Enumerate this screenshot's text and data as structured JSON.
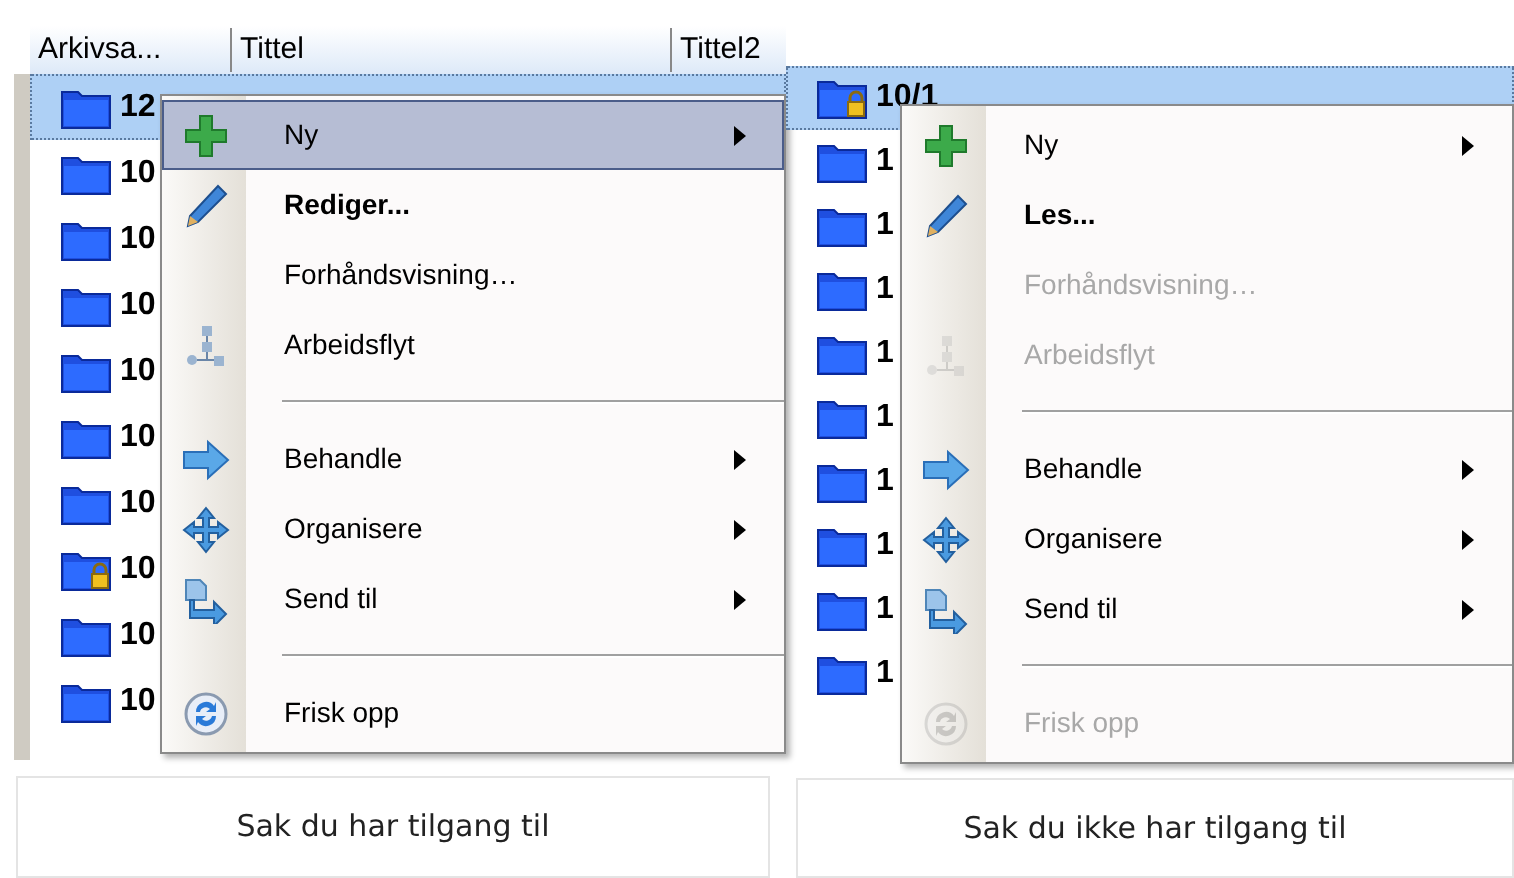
{
  "panels": [
    {
      "header": {
        "columns": [
          "Arkivsa...",
          "Tittel",
          "Tittel2"
        ]
      },
      "rows": [
        {
          "number": "12",
          "selected": true,
          "locked": false
        },
        {
          "number": "10",
          "selected": false,
          "locked": false
        },
        {
          "number": "10",
          "selected": false,
          "locked": false
        },
        {
          "number": "10",
          "selected": false,
          "locked": false
        },
        {
          "number": "10",
          "selected": false,
          "locked": false
        },
        {
          "number": "10",
          "selected": false,
          "locked": false
        },
        {
          "number": "10",
          "selected": false,
          "locked": false
        },
        {
          "number": "10",
          "selected": false,
          "locked": true
        },
        {
          "number": "10",
          "selected": false,
          "locked": false
        },
        {
          "number": "10",
          "selected": false,
          "locked": false
        }
      ],
      "menu": {
        "items": [
          {
            "kind": "item",
            "label": "Ny",
            "bold": false,
            "disabled": false,
            "submenu": true,
            "selected": true
          },
          {
            "kind": "item",
            "label": "Rediger...",
            "bold": true,
            "disabled": false,
            "submenu": false,
            "selected": false
          },
          {
            "kind": "item",
            "label": "Forhåndsvisning…",
            "bold": false,
            "disabled": false,
            "submenu": false,
            "selected": false
          },
          {
            "kind": "item",
            "label": "Arbeidsflyt",
            "bold": false,
            "disabled": false,
            "submenu": false,
            "selected": false
          },
          {
            "kind": "separator"
          },
          {
            "kind": "item",
            "label": "Behandle",
            "bold": false,
            "disabled": false,
            "submenu": true,
            "selected": false
          },
          {
            "kind": "item",
            "label": "Organisere",
            "bold": false,
            "disabled": false,
            "submenu": true,
            "selected": false
          },
          {
            "kind": "item",
            "label": "Send til",
            "bold": false,
            "disabled": false,
            "submenu": true,
            "selected": false
          },
          {
            "kind": "separator"
          },
          {
            "kind": "item",
            "label": "Frisk opp",
            "bold": false,
            "disabled": false,
            "submenu": false,
            "selected": false
          }
        ]
      },
      "caption": "Sak du har tilgang til"
    },
    {
      "rows": [
        {
          "number": "10/1",
          "selected": true,
          "locked": true
        },
        {
          "number": "1",
          "selected": false,
          "locked": false
        },
        {
          "number": "1",
          "selected": false,
          "locked": false
        },
        {
          "number": "1",
          "selected": false,
          "locked": false
        },
        {
          "number": "1",
          "selected": false,
          "locked": false
        },
        {
          "number": "1",
          "selected": false,
          "locked": false
        },
        {
          "number": "1",
          "selected": false,
          "locked": false
        },
        {
          "number": "1",
          "selected": false,
          "locked": false
        },
        {
          "number": "1",
          "selected": false,
          "locked": false
        },
        {
          "number": "1",
          "selected": false,
          "locked": false
        }
      ],
      "menu": {
        "items": [
          {
            "kind": "item",
            "label": "Ny",
            "bold": false,
            "disabled": false,
            "submenu": true,
            "selected": false
          },
          {
            "kind": "item",
            "label": "Les...",
            "bold": true,
            "disabled": false,
            "submenu": false,
            "selected": false
          },
          {
            "kind": "item",
            "label": "Forhåndsvisning…",
            "bold": false,
            "disabled": true,
            "submenu": false,
            "selected": false
          },
          {
            "kind": "item",
            "label": "Arbeidsflyt",
            "bold": false,
            "disabled": true,
            "submenu": false,
            "selected": false
          },
          {
            "kind": "separator"
          },
          {
            "kind": "item",
            "label": "Behandle",
            "bold": false,
            "disabled": false,
            "submenu": true,
            "selected": false
          },
          {
            "kind": "item",
            "label": "Organisere",
            "bold": false,
            "disabled": false,
            "submenu": true,
            "selected": false
          },
          {
            "kind": "item",
            "label": "Send til",
            "bold": false,
            "disabled": false,
            "submenu": true,
            "selected": false
          },
          {
            "kind": "separator"
          },
          {
            "kind": "item",
            "label": "Frisk opp",
            "bold": false,
            "disabled": true,
            "submenu": false,
            "selected": false
          }
        ]
      },
      "caption": "Sak du ikke har tilgang til"
    }
  ]
}
